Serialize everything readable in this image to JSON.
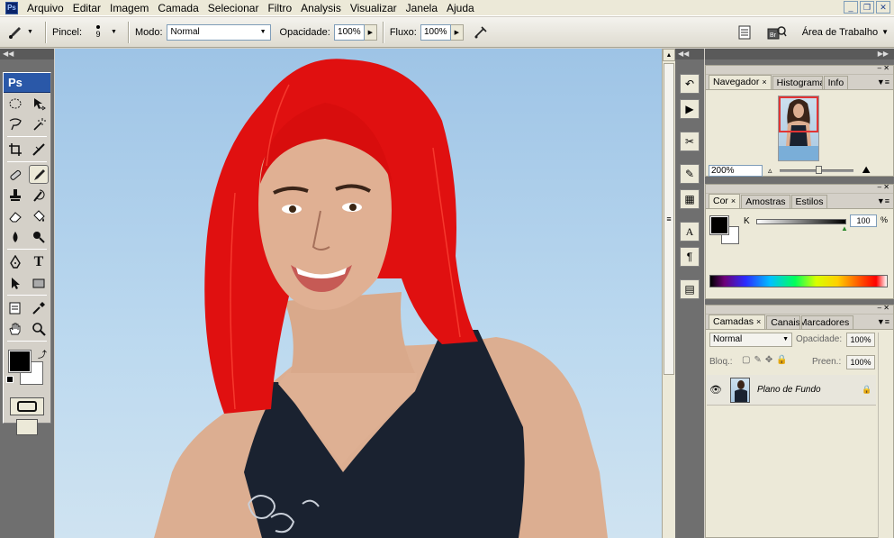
{
  "app": {
    "logo": "Ps"
  },
  "menu": [
    "Arquivo",
    "Editar",
    "Imagem",
    "Camada",
    "Selecionar",
    "Filtro",
    "Analysis",
    "Visualizar",
    "Janela",
    "Ajuda"
  ],
  "window_controls": {
    "minimize": "_",
    "restore": "❐",
    "close": "✕"
  },
  "options_bar": {
    "brush_label": "Pincel:",
    "brush_size": "9",
    "mode_label": "Modo:",
    "mode_value": "Normal",
    "opacity_label": "Opacidade:",
    "opacity_value": "100%",
    "flow_label": "Fluxo:",
    "flow_value": "100%",
    "workspace_label": "Área de Trabalho"
  },
  "toolbox": {
    "logo": "Ps"
  },
  "panels": {
    "navigator": {
      "tabs": [
        "Navegador",
        "Histograma",
        "Info"
      ],
      "close": "×",
      "zoom": "200%"
    },
    "color": {
      "tabs": [
        "Cor",
        "Amostras",
        "Estilos"
      ],
      "close": "×",
      "channel_label": "K",
      "channel_value": "100",
      "unit": "%"
    },
    "layers": {
      "tabs": [
        "Camadas",
        "Canais",
        "Marcadores"
      ],
      "close": "×",
      "blend_mode": "Normal",
      "opacity_label": "Opacidade:",
      "opacity_value": "100%",
      "lock_label": "Bloq.:",
      "fill_label": "Preen.:",
      "fill_value": "100%",
      "layer_name": "Plano de Fundo"
    }
  },
  "colors": {
    "foreground": "#000000",
    "background": "#ffffff",
    "hair": "#e01010",
    "sky": "#a9cbe8",
    "skin": "#e2b79a",
    "swimsuit": "#1a2230"
  }
}
